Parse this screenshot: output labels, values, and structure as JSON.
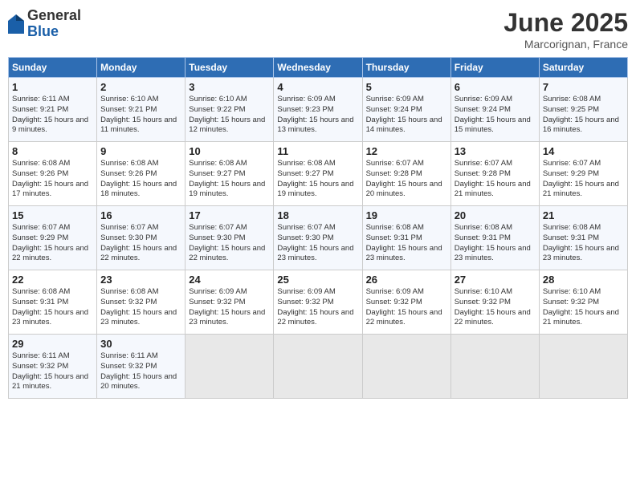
{
  "header": {
    "logo_general": "General",
    "logo_blue": "Blue",
    "title": "June 2025",
    "subtitle": "Marcorignan, France"
  },
  "days_of_week": [
    "Sunday",
    "Monday",
    "Tuesday",
    "Wednesday",
    "Thursday",
    "Friday",
    "Saturday"
  ],
  "weeks": [
    [
      {
        "day": "1",
        "sunrise": "6:11 AM",
        "sunset": "9:21 PM",
        "daylight": "15 hours and 9 minutes."
      },
      {
        "day": "2",
        "sunrise": "6:10 AM",
        "sunset": "9:21 PM",
        "daylight": "15 hours and 11 minutes."
      },
      {
        "day": "3",
        "sunrise": "6:10 AM",
        "sunset": "9:22 PM",
        "daylight": "15 hours and 12 minutes."
      },
      {
        "day": "4",
        "sunrise": "6:09 AM",
        "sunset": "9:23 PM",
        "daylight": "15 hours and 13 minutes."
      },
      {
        "day": "5",
        "sunrise": "6:09 AM",
        "sunset": "9:24 PM",
        "daylight": "15 hours and 14 minutes."
      },
      {
        "day": "6",
        "sunrise": "6:09 AM",
        "sunset": "9:24 PM",
        "daylight": "15 hours and 15 minutes."
      },
      {
        "day": "7",
        "sunrise": "6:08 AM",
        "sunset": "9:25 PM",
        "daylight": "15 hours and 16 minutes."
      }
    ],
    [
      {
        "day": "8",
        "sunrise": "6:08 AM",
        "sunset": "9:26 PM",
        "daylight": "15 hours and 17 minutes."
      },
      {
        "day": "9",
        "sunrise": "6:08 AM",
        "sunset": "9:26 PM",
        "daylight": "15 hours and 18 minutes."
      },
      {
        "day": "10",
        "sunrise": "6:08 AM",
        "sunset": "9:27 PM",
        "daylight": "15 hours and 19 minutes."
      },
      {
        "day": "11",
        "sunrise": "6:08 AM",
        "sunset": "9:27 PM",
        "daylight": "15 hours and 19 minutes."
      },
      {
        "day": "12",
        "sunrise": "6:07 AM",
        "sunset": "9:28 PM",
        "daylight": "15 hours and 20 minutes."
      },
      {
        "day": "13",
        "sunrise": "6:07 AM",
        "sunset": "9:28 PM",
        "daylight": "15 hours and 21 minutes."
      },
      {
        "day": "14",
        "sunrise": "6:07 AM",
        "sunset": "9:29 PM",
        "daylight": "15 hours and 21 minutes."
      }
    ],
    [
      {
        "day": "15",
        "sunrise": "6:07 AM",
        "sunset": "9:29 PM",
        "daylight": "15 hours and 22 minutes."
      },
      {
        "day": "16",
        "sunrise": "6:07 AM",
        "sunset": "9:30 PM",
        "daylight": "15 hours and 22 minutes."
      },
      {
        "day": "17",
        "sunrise": "6:07 AM",
        "sunset": "9:30 PM",
        "daylight": "15 hours and 22 minutes."
      },
      {
        "day": "18",
        "sunrise": "6:07 AM",
        "sunset": "9:30 PM",
        "daylight": "15 hours and 23 minutes."
      },
      {
        "day": "19",
        "sunrise": "6:08 AM",
        "sunset": "9:31 PM",
        "daylight": "15 hours and 23 minutes."
      },
      {
        "day": "20",
        "sunrise": "6:08 AM",
        "sunset": "9:31 PM",
        "daylight": "15 hours and 23 minutes."
      },
      {
        "day": "21",
        "sunrise": "6:08 AM",
        "sunset": "9:31 PM",
        "daylight": "15 hours and 23 minutes."
      }
    ],
    [
      {
        "day": "22",
        "sunrise": "6:08 AM",
        "sunset": "9:31 PM",
        "daylight": "15 hours and 23 minutes."
      },
      {
        "day": "23",
        "sunrise": "6:08 AM",
        "sunset": "9:32 PM",
        "daylight": "15 hours and 23 minutes."
      },
      {
        "day": "24",
        "sunrise": "6:09 AM",
        "sunset": "9:32 PM",
        "daylight": "15 hours and 23 minutes."
      },
      {
        "day": "25",
        "sunrise": "6:09 AM",
        "sunset": "9:32 PM",
        "daylight": "15 hours and 22 minutes."
      },
      {
        "day": "26",
        "sunrise": "6:09 AM",
        "sunset": "9:32 PM",
        "daylight": "15 hours and 22 minutes."
      },
      {
        "day": "27",
        "sunrise": "6:10 AM",
        "sunset": "9:32 PM",
        "daylight": "15 hours and 22 minutes."
      },
      {
        "day": "28",
        "sunrise": "6:10 AM",
        "sunset": "9:32 PM",
        "daylight": "15 hours and 21 minutes."
      }
    ],
    [
      {
        "day": "29",
        "sunrise": "6:11 AM",
        "sunset": "9:32 PM",
        "daylight": "15 hours and 21 minutes."
      },
      {
        "day": "30",
        "sunrise": "6:11 AM",
        "sunset": "9:32 PM",
        "daylight": "15 hours and 20 minutes."
      },
      {
        "day": "",
        "sunrise": "",
        "sunset": "",
        "daylight": ""
      },
      {
        "day": "",
        "sunrise": "",
        "sunset": "",
        "daylight": ""
      },
      {
        "day": "",
        "sunrise": "",
        "sunset": "",
        "daylight": ""
      },
      {
        "day": "",
        "sunrise": "",
        "sunset": "",
        "daylight": ""
      },
      {
        "day": "",
        "sunrise": "",
        "sunset": "",
        "daylight": ""
      }
    ]
  ],
  "labels": {
    "sunrise": "Sunrise: ",
    "sunset": "Sunset: ",
    "daylight": "Daylight: "
  }
}
